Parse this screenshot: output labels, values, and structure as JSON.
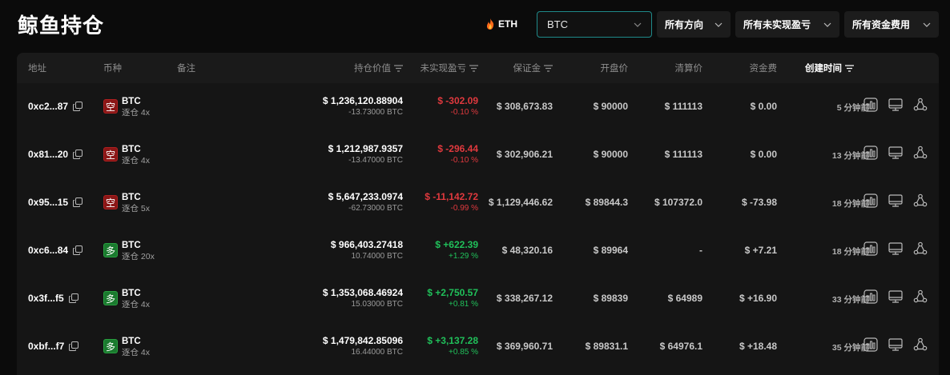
{
  "page": {
    "title": "鲸鱼持仓"
  },
  "controls": {
    "eth_label": "ETH",
    "coin_select_value": "BTC",
    "direction_filter": "所有方向",
    "pnl_filter": "所有未实现盈亏",
    "funding_filter": "所有资金费用"
  },
  "table": {
    "columns": {
      "address": "地址",
      "coin": "币种",
      "note": "备注",
      "position_value": "持仓价值",
      "unrealized_pnl": "未实现盈亏",
      "margin": "保证金",
      "open_price": "开盘价",
      "liq_price": "清算价",
      "funding": "资金费",
      "created": "创建时间"
    },
    "rows": [
      {
        "address": "0xc2...87",
        "side": "空",
        "side_type": "short",
        "coin": "BTC",
        "leverage": "逐仓 4x",
        "value": "$ 1,236,120.88904",
        "size": "-13.73000 BTC",
        "pnl": "$ -302.09",
        "pnl_pct": "-0.10 %",
        "pnl_type": "neg",
        "margin": "$ 308,673.83",
        "open": "$ 90000",
        "liq": "$ 111113",
        "fee": "$ 0.00",
        "fee_type": "plain",
        "time": "5 分钟前"
      },
      {
        "address": "0x81...20",
        "side": "空",
        "side_type": "short",
        "coin": "BTC",
        "leverage": "逐仓 4x",
        "value": "$ 1,212,987.9357",
        "size": "-13.47000 BTC",
        "pnl": "$ -296.44",
        "pnl_pct": "-0.10 %",
        "pnl_type": "neg",
        "margin": "$ 302,906.21",
        "open": "$ 90000",
        "liq": "$ 111113",
        "fee": "$ 0.00",
        "fee_type": "plain",
        "time": "13 分钟前"
      },
      {
        "address": "0x95...15",
        "side": "空",
        "side_type": "short",
        "coin": "BTC",
        "leverage": "逐仓 5x",
        "value": "$ 5,647,233.0974",
        "size": "-62.73000 BTC",
        "pnl": "$ -11,142.72",
        "pnl_pct": "-0.99 %",
        "pnl_type": "neg",
        "margin": "$ 1,129,446.62",
        "open": "$ 89844.3",
        "liq": "$ 107372.0",
        "fee": "$ -73.98",
        "fee_type": "neg",
        "time": "18 分钟前"
      },
      {
        "address": "0xc6...84",
        "side": "多",
        "side_type": "long",
        "coin": "BTC",
        "leverage": "逐仓 20x",
        "value": "$ 966,403.27418",
        "size": "10.74000 BTC",
        "pnl": "$ +622.39",
        "pnl_pct": "+1.29 %",
        "pnl_type": "pos",
        "margin": "$ 48,320.16",
        "open": "$ 89964",
        "liq": "-",
        "fee": "$ +7.21",
        "fee_type": "pos",
        "time": "18 分钟前"
      },
      {
        "address": "0x3f...f5",
        "side": "多",
        "side_type": "long",
        "coin": "BTC",
        "leverage": "逐仓 4x",
        "value": "$ 1,353,068.46924",
        "size": "15.03000 BTC",
        "pnl": "$ +2,750.57",
        "pnl_pct": "+0.81 %",
        "pnl_type": "pos",
        "margin": "$ 338,267.12",
        "open": "$ 89839",
        "liq": "$ 64989",
        "fee": "$ +16.90",
        "fee_type": "pos",
        "time": "33 分钟前"
      },
      {
        "address": "0xbf...f7",
        "side": "多",
        "side_type": "long",
        "coin": "BTC",
        "leverage": "逐仓 4x",
        "value": "$ 1,479,842.85096",
        "size": "16.44000 BTC",
        "pnl": "$ +3,137.28",
        "pnl_pct": "+0.85 %",
        "pnl_type": "pos",
        "margin": "$ 369,960.71",
        "open": "$ 89831.1",
        "liq": "$ 64976.1",
        "fee": "$ +18.48",
        "fee_type": "pos",
        "time": "35 分钟前"
      }
    ]
  }
}
